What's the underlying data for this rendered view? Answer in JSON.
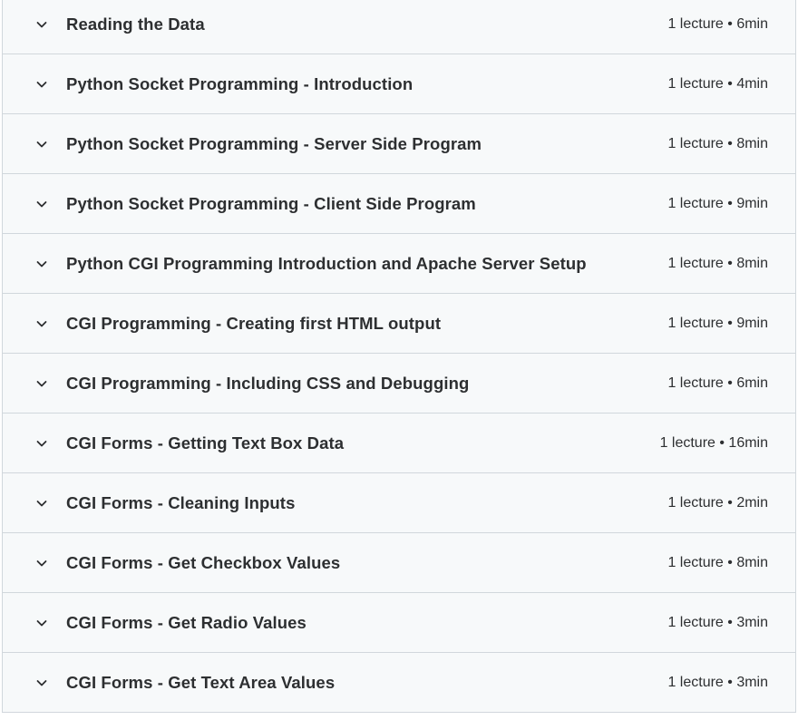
{
  "sections": [
    {
      "title": "Reading the Data",
      "meta": "1 lecture • 6min"
    },
    {
      "title": "Python Socket Programming - Introduction",
      "meta": "1 lecture • 4min"
    },
    {
      "title": "Python Socket Programming - Server Side Program",
      "meta": "1 lecture • 8min"
    },
    {
      "title": "Python Socket Programming - Client Side Program",
      "meta": "1 lecture • 9min"
    },
    {
      "title": "Python CGI Programming Introduction and Apache Server Setup",
      "meta": "1 lecture • 8min"
    },
    {
      "title": "CGI Programming - Creating first HTML output",
      "meta": "1 lecture • 9min"
    },
    {
      "title": "CGI Programming - Including CSS and Debugging",
      "meta": "1 lecture • 6min"
    },
    {
      "title": "CGI Forms - Getting Text Box Data",
      "meta": "1 lecture • 16min"
    },
    {
      "title": "CGI Forms - Cleaning Inputs",
      "meta": "1 lecture • 2min"
    },
    {
      "title": "CGI Forms - Get Checkbox Values",
      "meta": "1 lecture • 8min"
    },
    {
      "title": "CGI Forms - Get Radio Values",
      "meta": "1 lecture • 3min"
    },
    {
      "title": "CGI Forms - Get Text Area Values",
      "meta": "1 lecture • 3min"
    }
  ],
  "colors": {
    "row_bg": "#f7f9fa",
    "border": "#d1d7dc",
    "text": "#2d2f31"
  },
  "icons": {
    "expand": "chevron-down-icon"
  }
}
